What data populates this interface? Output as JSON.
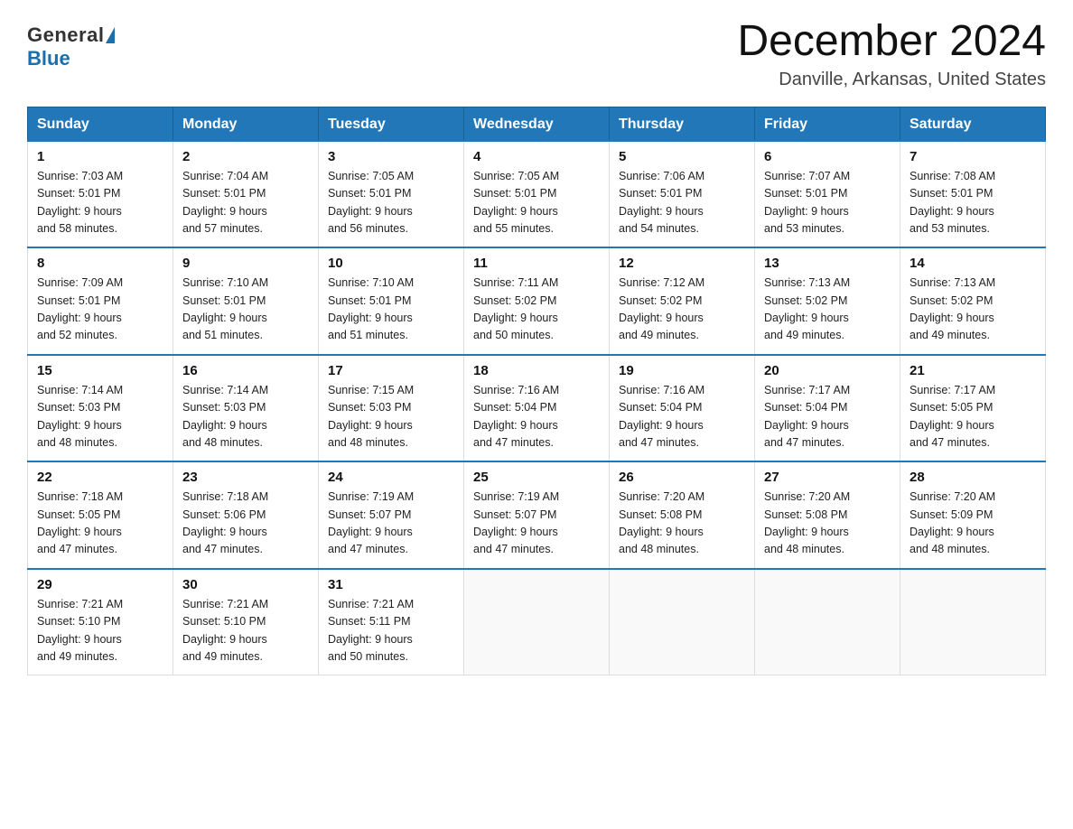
{
  "header": {
    "logo_general": "General",
    "logo_blue": "Blue",
    "month_title": "December 2024",
    "location": "Danville, Arkansas, United States"
  },
  "days_of_week": [
    "Sunday",
    "Monday",
    "Tuesday",
    "Wednesday",
    "Thursday",
    "Friday",
    "Saturday"
  ],
  "weeks": [
    [
      {
        "day": "1",
        "sunrise": "7:03 AM",
        "sunset": "5:01 PM",
        "daylight": "9 hours and 58 minutes."
      },
      {
        "day": "2",
        "sunrise": "7:04 AM",
        "sunset": "5:01 PM",
        "daylight": "9 hours and 57 minutes."
      },
      {
        "day": "3",
        "sunrise": "7:05 AM",
        "sunset": "5:01 PM",
        "daylight": "9 hours and 56 minutes."
      },
      {
        "day": "4",
        "sunrise": "7:05 AM",
        "sunset": "5:01 PM",
        "daylight": "9 hours and 55 minutes."
      },
      {
        "day": "5",
        "sunrise": "7:06 AM",
        "sunset": "5:01 PM",
        "daylight": "9 hours and 54 minutes."
      },
      {
        "day": "6",
        "sunrise": "7:07 AM",
        "sunset": "5:01 PM",
        "daylight": "9 hours and 53 minutes."
      },
      {
        "day": "7",
        "sunrise": "7:08 AM",
        "sunset": "5:01 PM",
        "daylight": "9 hours and 53 minutes."
      }
    ],
    [
      {
        "day": "8",
        "sunrise": "7:09 AM",
        "sunset": "5:01 PM",
        "daylight": "9 hours and 52 minutes."
      },
      {
        "day": "9",
        "sunrise": "7:10 AM",
        "sunset": "5:01 PM",
        "daylight": "9 hours and 51 minutes."
      },
      {
        "day": "10",
        "sunrise": "7:10 AM",
        "sunset": "5:01 PM",
        "daylight": "9 hours and 51 minutes."
      },
      {
        "day": "11",
        "sunrise": "7:11 AM",
        "sunset": "5:02 PM",
        "daylight": "9 hours and 50 minutes."
      },
      {
        "day": "12",
        "sunrise": "7:12 AM",
        "sunset": "5:02 PM",
        "daylight": "9 hours and 49 minutes."
      },
      {
        "day": "13",
        "sunrise": "7:13 AM",
        "sunset": "5:02 PM",
        "daylight": "9 hours and 49 minutes."
      },
      {
        "day": "14",
        "sunrise": "7:13 AM",
        "sunset": "5:02 PM",
        "daylight": "9 hours and 49 minutes."
      }
    ],
    [
      {
        "day": "15",
        "sunrise": "7:14 AM",
        "sunset": "5:03 PM",
        "daylight": "9 hours and 48 minutes."
      },
      {
        "day": "16",
        "sunrise": "7:14 AM",
        "sunset": "5:03 PM",
        "daylight": "9 hours and 48 minutes."
      },
      {
        "day": "17",
        "sunrise": "7:15 AM",
        "sunset": "5:03 PM",
        "daylight": "9 hours and 48 minutes."
      },
      {
        "day": "18",
        "sunrise": "7:16 AM",
        "sunset": "5:04 PM",
        "daylight": "9 hours and 47 minutes."
      },
      {
        "day": "19",
        "sunrise": "7:16 AM",
        "sunset": "5:04 PM",
        "daylight": "9 hours and 47 minutes."
      },
      {
        "day": "20",
        "sunrise": "7:17 AM",
        "sunset": "5:04 PM",
        "daylight": "9 hours and 47 minutes."
      },
      {
        "day": "21",
        "sunrise": "7:17 AM",
        "sunset": "5:05 PM",
        "daylight": "9 hours and 47 minutes."
      }
    ],
    [
      {
        "day": "22",
        "sunrise": "7:18 AM",
        "sunset": "5:05 PM",
        "daylight": "9 hours and 47 minutes."
      },
      {
        "day": "23",
        "sunrise": "7:18 AM",
        "sunset": "5:06 PM",
        "daylight": "9 hours and 47 minutes."
      },
      {
        "day": "24",
        "sunrise": "7:19 AM",
        "sunset": "5:07 PM",
        "daylight": "9 hours and 47 minutes."
      },
      {
        "day": "25",
        "sunrise": "7:19 AM",
        "sunset": "5:07 PM",
        "daylight": "9 hours and 47 minutes."
      },
      {
        "day": "26",
        "sunrise": "7:20 AM",
        "sunset": "5:08 PM",
        "daylight": "9 hours and 48 minutes."
      },
      {
        "day": "27",
        "sunrise": "7:20 AM",
        "sunset": "5:08 PM",
        "daylight": "9 hours and 48 minutes."
      },
      {
        "day": "28",
        "sunrise": "7:20 AM",
        "sunset": "5:09 PM",
        "daylight": "9 hours and 48 minutes."
      }
    ],
    [
      {
        "day": "29",
        "sunrise": "7:21 AM",
        "sunset": "5:10 PM",
        "daylight": "9 hours and 49 minutes."
      },
      {
        "day": "30",
        "sunrise": "7:21 AM",
        "sunset": "5:10 PM",
        "daylight": "9 hours and 49 minutes."
      },
      {
        "day": "31",
        "sunrise": "7:21 AM",
        "sunset": "5:11 PM",
        "daylight": "9 hours and 50 minutes."
      },
      null,
      null,
      null,
      null
    ]
  ]
}
